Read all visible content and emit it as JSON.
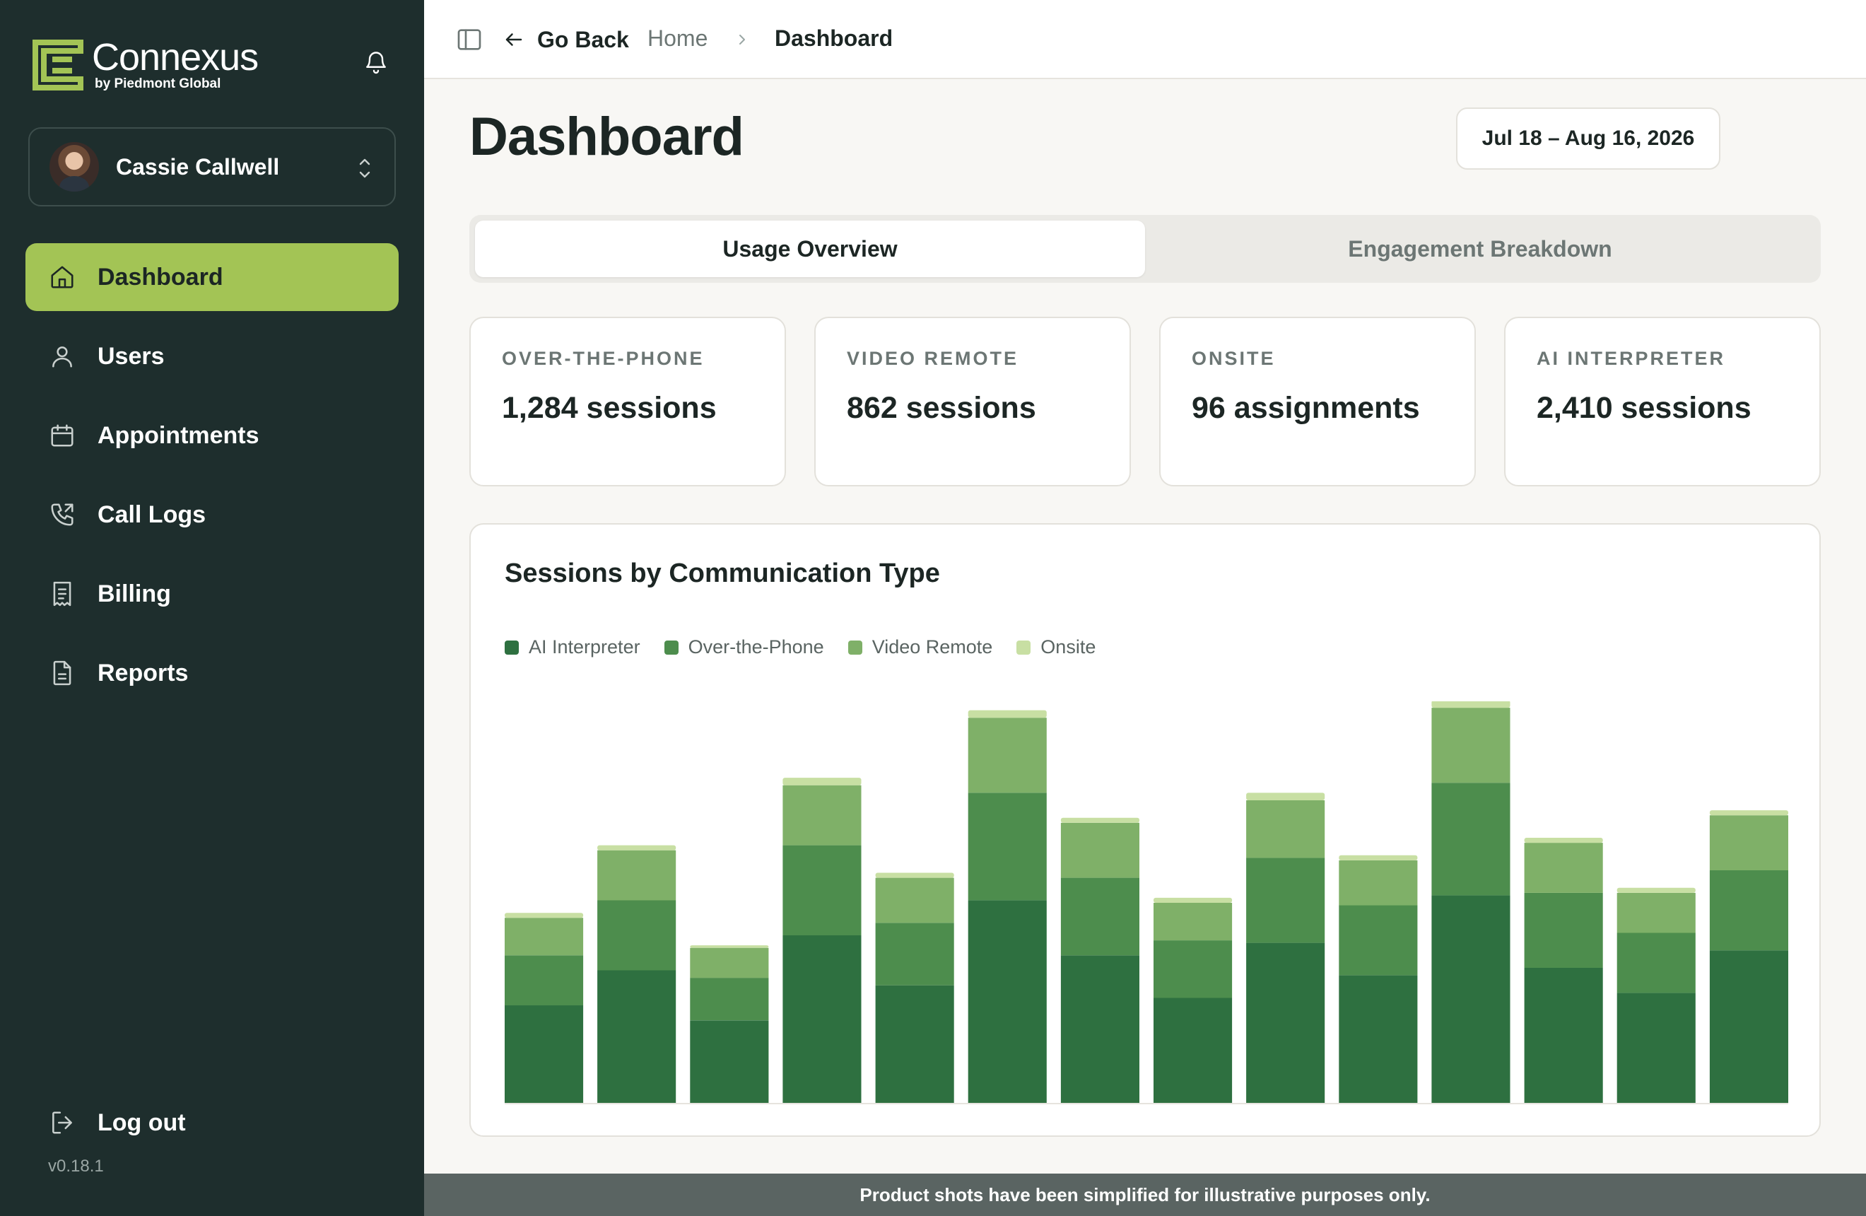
{
  "brand": {
    "name": "Connexus",
    "sub": "by Piedmont Global"
  },
  "user": {
    "name": "Cassie Callwell"
  },
  "sidebar": {
    "items": [
      {
        "label": "Dashboard",
        "icon": "home-icon",
        "active": true
      },
      {
        "label": "Users",
        "icon": "user-icon",
        "active": false
      },
      {
        "label": "Appointments",
        "icon": "calendar-icon",
        "active": false
      },
      {
        "label": "Call Logs",
        "icon": "phone-icon",
        "active": false
      },
      {
        "label": "Billing",
        "icon": "receipt-icon",
        "active": false
      },
      {
        "label": "Reports",
        "icon": "document-icon",
        "active": false
      }
    ],
    "logout_label": "Log out",
    "version": "v0.18.1"
  },
  "topbar": {
    "go_back_label": "Go Back",
    "breadcrumb": {
      "home": "Home",
      "current": "Dashboard"
    }
  },
  "main": {
    "title": "Dashboard",
    "date_range": "Jul 18 – Aug 16, 2026",
    "tabs": [
      {
        "label": "Usage Overview",
        "active": true
      },
      {
        "label": "Engagement Breakdown",
        "active": false
      }
    ],
    "stats": [
      {
        "label": "OVER-THE-PHONE",
        "value": "1,284 sessions"
      },
      {
        "label": "VIDEO REMOTE",
        "value": "862 sessions"
      },
      {
        "label": "ONSITE",
        "value": "96 assignments"
      },
      {
        "label": "AI INTERPRETER",
        "value": "2,410 sessions"
      }
    ]
  },
  "chart_data": {
    "type": "bar",
    "stacked": true,
    "title": "Sessions by Communication Type",
    "legend_position": "top-left",
    "grid": false,
    "ylim": [
      0,
      160
    ],
    "categories": [
      "",
      "",
      "",
      "",
      "",
      "",
      "",
      "",
      "",
      "",
      "",
      "",
      "",
      "",
      ""
    ],
    "series": [
      {
        "name": "AI Interpreter",
        "color": "#2e7040",
        "values": [
          39,
          53,
          33,
          67,
          47,
          81,
          59,
          42,
          64,
          51,
          83,
          54,
          44,
          61
        ]
      },
      {
        "name": "Over-the-Phone",
        "color": "#4d8d4d",
        "values": [
          20,
          28,
          17,
          36,
          25,
          43,
          31,
          23,
          34,
          28,
          45,
          30,
          24,
          32
        ]
      },
      {
        "name": "Video Remote",
        "color": "#7fb068",
        "values": [
          15,
          20,
          12,
          24,
          18,
          30,
          22,
          15,
          23,
          18,
          30,
          20,
          16,
          22
        ]
      },
      {
        "name": "Onsite",
        "color": "#c8dfa3",
        "values": [
          2,
          2,
          1,
          3,
          2,
          3,
          2,
          2,
          3,
          2,
          3,
          2,
          2,
          2
        ]
      }
    ]
  },
  "footer": {
    "note": "Product shots have been simplified for illustrative purposes only."
  },
  "colors": {
    "sidebar_bg": "#1e2e2d",
    "accent": "#a3c455",
    "page_bg": "#f8f7f4"
  }
}
